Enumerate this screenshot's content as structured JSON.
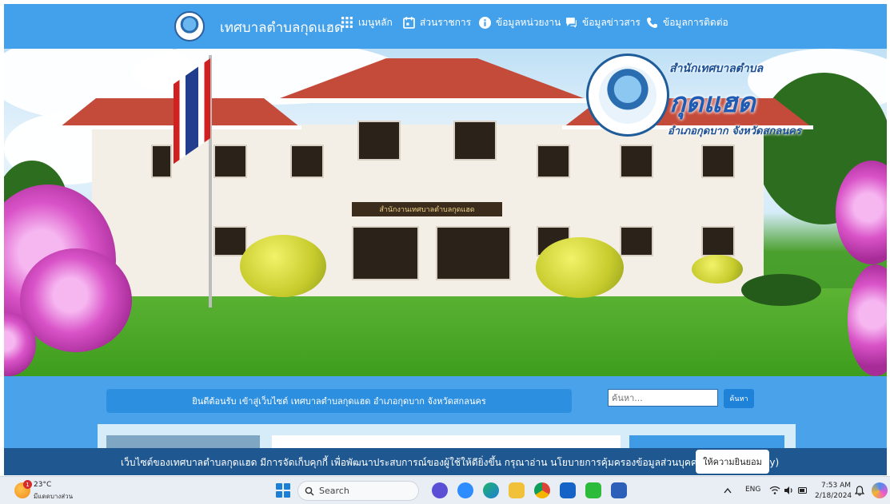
{
  "site": {
    "title": "เทศบาลตำบลกุดแฮด"
  },
  "nav": {
    "items": [
      {
        "label": "เมนูหลัก",
        "icon": "grid-icon"
      },
      {
        "label": "ส่วนราชการ",
        "icon": "calendar-icon"
      },
      {
        "label": "ข้อมูลหน่วยงาน",
        "icon": "info-icon"
      },
      {
        "label": "ข้อมูลข่าวสาร",
        "icon": "chat-icon"
      },
      {
        "label": "ข้อมูลการติดต่อ",
        "icon": "phone-icon"
      }
    ]
  },
  "hero": {
    "org_line1": "สำนักเทศบาลตำบล",
    "org_line2": "กุดแฮด",
    "org_line3": "อำเภอกุดบาก จังหวัดสกลนคร",
    "building_sign": "สำนักงานเทศบาลตำบลกุดแฮด"
  },
  "welcome": {
    "text": "ยินดีต้อนรับ เข้าสู่เว็บไซต์ เทศบาลตำบลกุดแฮด อำเภอกุดบาก จังหวัดสกลนคร"
  },
  "search": {
    "placeholder": "ค้นหา...",
    "button_label": "ค้นหา"
  },
  "cookie": {
    "text": "เว็บไซต์ของเทศบาลตำบลกุดแฮด มีการจัดเก็บคุกกี้ เพื่อพัฒนาประสบการณ์ของผู้ใช้ให้ดียิ่งขึ้น กรุณาอ่าน นโยบายการคุ้มครองข้อมูลส่วนบุคคล (Privacy Policy)",
    "accept_label": "ให้ความยินยอม"
  },
  "taskbar": {
    "weather_temp": "23°C",
    "weather_desc": "มีแดดบางส่วน",
    "weather_badge": "1",
    "search_label": "Search",
    "tray_lang": "ENG",
    "time": "7:53 AM",
    "date": "2/18/2024"
  },
  "colors": {
    "nav_bg": "#43a0ea",
    "band_bg": "#4aa3ea",
    "cookie_bg": "#1f5890"
  }
}
